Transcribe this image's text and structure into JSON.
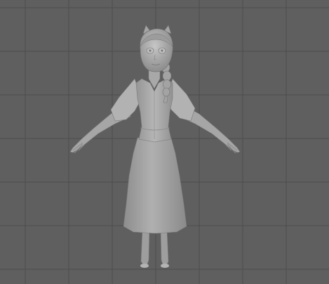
{
  "viewport": {
    "background": "#5f5f5f",
    "grid_line_color": "#4a4a4a",
    "model_color": "#a9a9a9",
    "model_shadow": "#7c7c7c",
    "model_highlight": "#c4c4c4",
    "shading_mode": "smooth-shaded",
    "subject": "character-model-t-pose"
  }
}
